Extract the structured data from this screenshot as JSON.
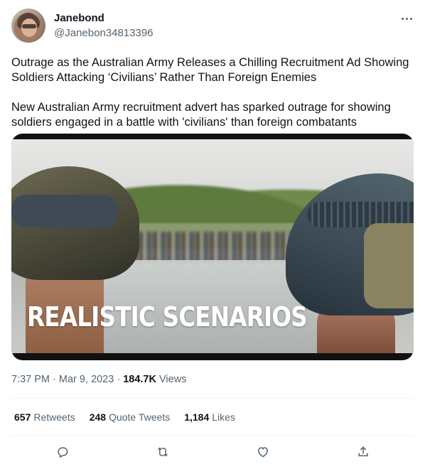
{
  "author": {
    "name": "Janebond",
    "handle": "@Janebon34813396"
  },
  "tweet": {
    "paragraph_1": "Outrage as the Australian Army Releases a Chilling Recruitment Ad Showing Soldiers Attacking ‘Civilians’ Rather Than Foreign Enemies",
    "paragraph_2": "New Australian Army recruitment advert has sparked outrage for showing soldiers engaged in a battle with 'civilians' than foreign combatants",
    "media_caption": "REALISTIC SCENARIOS"
  },
  "meta": {
    "time": "7:37 PM",
    "separator": "·",
    "date": "Mar 9, 2023",
    "views_count": "184.7K",
    "views_label": "Views"
  },
  "stats": [
    {
      "count": "657",
      "label": "Retweets"
    },
    {
      "count": "248",
      "label": "Quote Tweets"
    },
    {
      "count": "1,184",
      "label": "Likes"
    }
  ],
  "actions": [
    "reply-icon",
    "retweet-icon",
    "like-icon",
    "share-icon"
  ],
  "colors": {
    "text": "#0f1419",
    "secondary": "#536471",
    "divider": "#eff3f4"
  }
}
